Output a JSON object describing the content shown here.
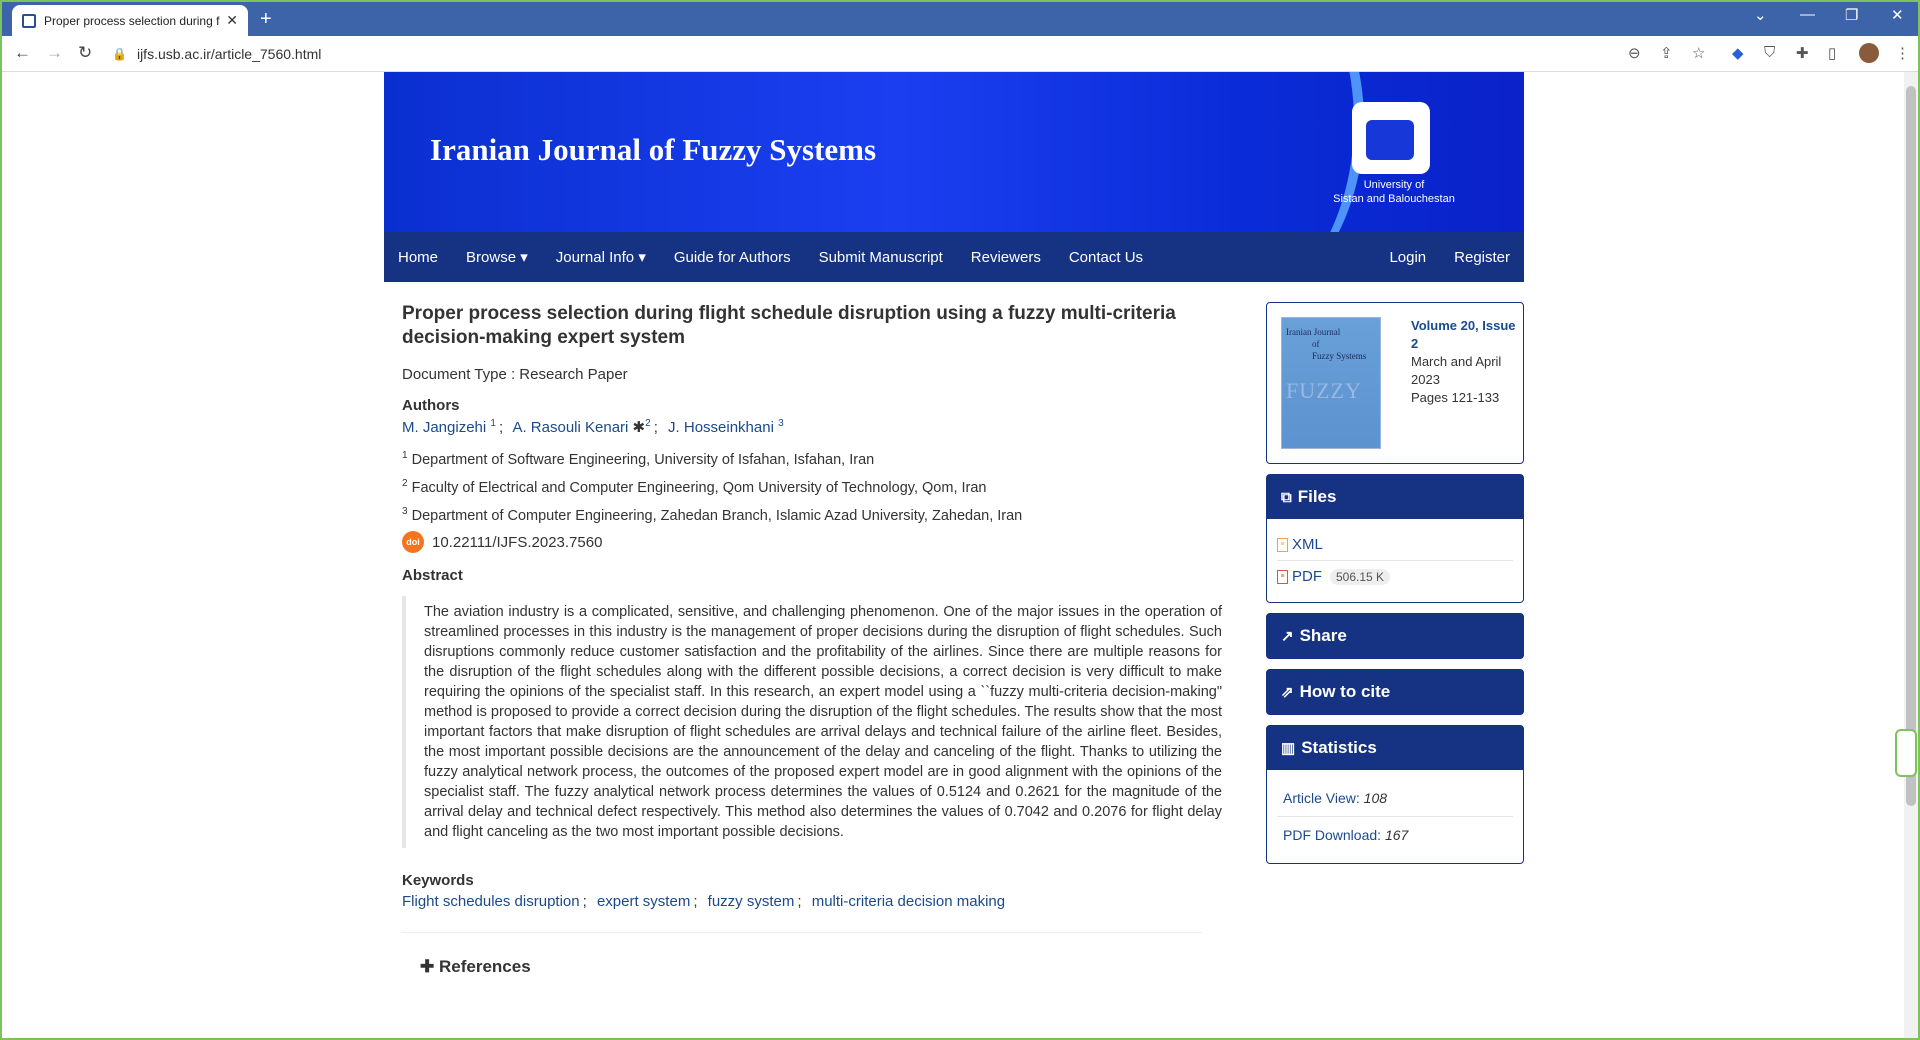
{
  "browser": {
    "tab_title": "Proper process selection during f",
    "url": "ijfs.usb.ac.ir/article_7560.html"
  },
  "header": {
    "journal_title": "Iranian Journal of Fuzzy Systems",
    "university_line1": "University of",
    "university_line2": "Sistan and Balouchestan"
  },
  "nav": {
    "items": [
      "Home",
      "Browse",
      "Journal Info",
      "Guide for Authors",
      "Submit Manuscript",
      "Reviewers",
      "Contact Us"
    ],
    "right": [
      "Login",
      "Register"
    ]
  },
  "article": {
    "title": "Proper process selection during flight schedule disruption using a fuzzy multi-criteria decision-making expert system",
    "document_type": "Document Type : Research Paper",
    "authors_heading": "Authors",
    "authors": [
      {
        "name": "M. Jangizehi",
        "sup": "1"
      },
      {
        "name": "A. Rasouli Kenari",
        "sup": "2"
      },
      {
        "name": "J. Hosseinkhani",
        "sup": "3"
      }
    ],
    "affiliations": [
      {
        "sup": "1",
        "text": "Department of Software Engineering, University of Isfahan, Isfahan, Iran"
      },
      {
        "sup": "2",
        "text": "Faculty of Electrical and Computer Engineering, Qom University of Technology, Qom, Iran"
      },
      {
        "sup": "3",
        "text": "Department of Computer Engineering, Zahedan Branch, Islamic Azad University, Zahedan, Iran"
      }
    ],
    "doi": "10.22111/IJFS.2023.7560",
    "abstract_heading": "Abstract",
    "abstract": "The aviation industry is a complicated, sensitive, and challenging phenomenon.  One of the major issues in the operation of streamlined processes in this industry is the management of proper decisions during the disruption of flight schedules. Such disruptions commonly reduce customer satisfaction and the profitability of the airlines. Since there are multiple reasons for the disruption of the flight schedules along with the different possible decisions, a correct decision is very difficult to make requiring the opinions of the specialist staff. In this research, an expert model using a ``fuzzy multi-criteria decision-making\" method is proposed to provide a correct decision during the disruption of the flight schedules. The results show that the most important factors that make disruption of flight schedules are arrival delays and technical failure of the airline fleet. Besides, the most important possible decisions are the announcement of the delay and canceling of the flight. Thanks to utilizing the fuzzy analytical network process, the outcomes of the proposed expert model are in good alignment with the opinions of the specialist staff. The fuzzy analytical network process determines the values of 0.5124 and 0.2621 for the magnitude of the arrival delay and technical defect respectively. This method also determines the values of 0.7042 and 0.2076 for flight delay and flight canceling as the two most important possible decisions.",
    "keywords_heading": "Keywords",
    "keywords": [
      "Flight schedules disruption",
      "expert system",
      "fuzzy system",
      "multi-criteria decision making"
    ],
    "references_label": "References"
  },
  "sidebar": {
    "cover_title_1": "Iranian Journal",
    "cover_title_2": "of",
    "cover_title_3": "Fuzzy Systems",
    "cover_big": "FUZZY",
    "issue_link": "Volume 20, Issue 2",
    "issue_date": "March and April 2023",
    "pages": "Pages 121-133",
    "files_heading": "Files",
    "xml_label": "XML",
    "pdf_label": "PDF",
    "pdf_size": "506.15 K",
    "share_heading": "Share",
    "cite_heading": "How to cite",
    "stats_heading": "Statistics",
    "article_view_label": "Article View:",
    "article_view_value": "108",
    "pdf_download_label": "PDF Download:",
    "pdf_download_value": "167"
  }
}
